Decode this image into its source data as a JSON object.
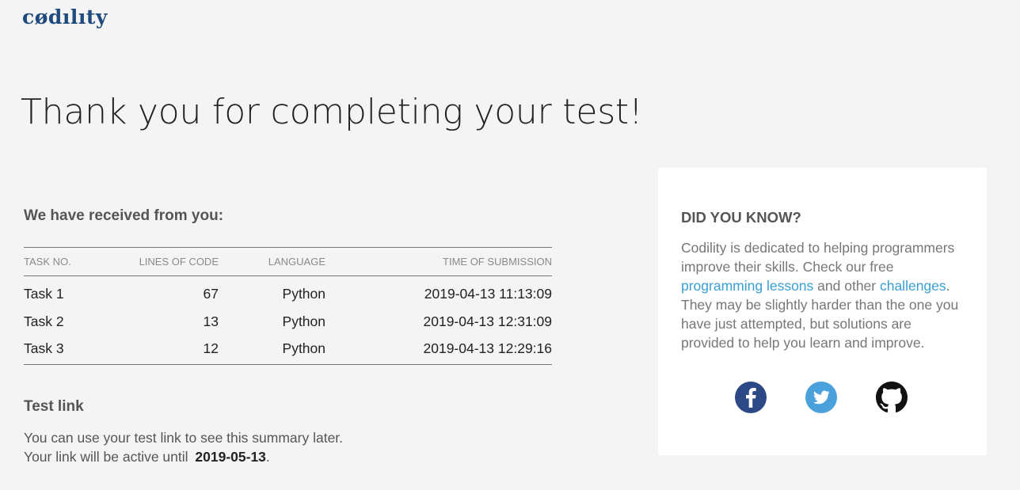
{
  "brand": {
    "logo_text": "cødılıty",
    "color": "#1f4a7d"
  },
  "headline": "Thank you for completing your test!",
  "received": {
    "title": "We have received from you:",
    "columns": [
      "TASK NO.",
      "LINES OF CODE",
      "LANGUAGE",
      "TIME OF SUBMISSION"
    ],
    "rows": [
      {
        "task": "Task 1",
        "lines": "67",
        "language": "Python",
        "time": "2019-04-13 11:13:09"
      },
      {
        "task": "Task 2",
        "lines": "13",
        "language": "Python",
        "time": "2019-04-13 12:31:09"
      },
      {
        "task": "Task 3",
        "lines": "12",
        "language": "Python",
        "time": "2019-04-13 12:29:16"
      }
    ]
  },
  "test_link": {
    "title": "Test link",
    "line1": "You can use your test link to see this summary later.",
    "line2_prefix": "Your link will be active until",
    "expiry_date": "2019-05-13",
    "line2_suffix": "."
  },
  "did_you_know": {
    "title": "DID YOU KNOW?",
    "text_1": "Codility is dedicated to helping programmers improve their skills. Check our free ",
    "link_lessons": "programming lessons",
    "text_2": " and other ",
    "link_challenges": "challenges",
    "text_3": ". They may be slightly harder than the one you have just attempted, but solutions are provided to help you learn and improve.",
    "link_color": "#39a0d4"
  },
  "social": [
    {
      "name": "facebook-icon",
      "color": "#2c4985"
    },
    {
      "name": "twitter-icon",
      "color": "#4aa1dc"
    },
    {
      "name": "github-icon",
      "color": "#111111"
    }
  ]
}
